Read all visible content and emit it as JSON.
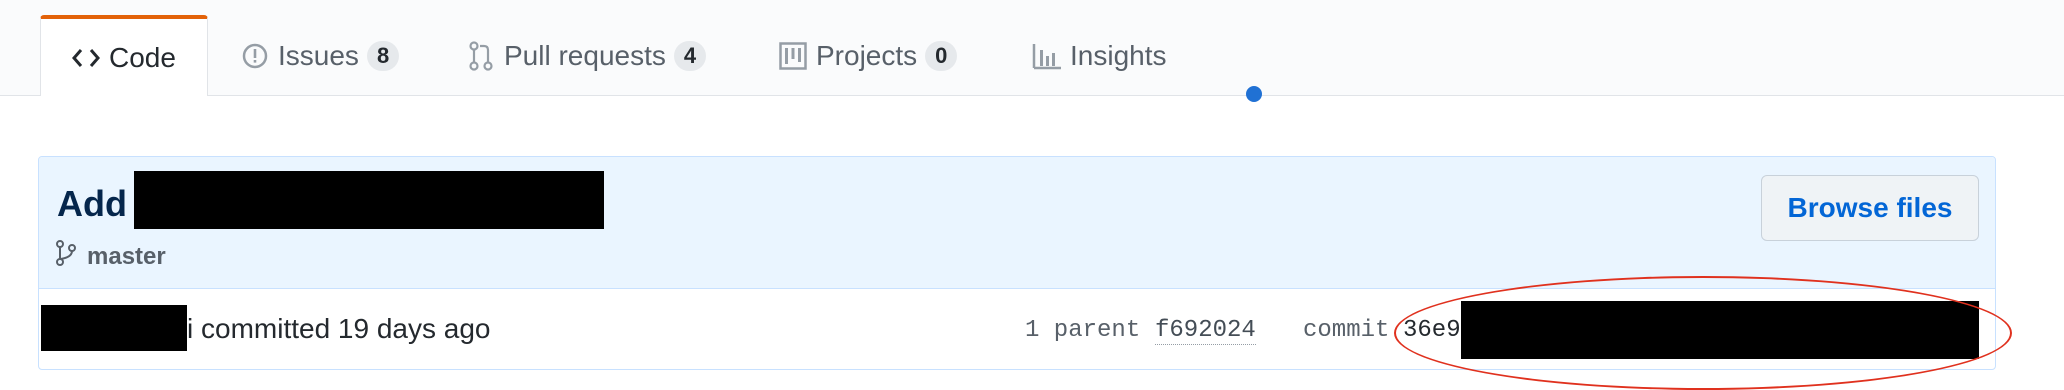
{
  "tabs": {
    "code": {
      "label": "Code",
      "icon": "code-icon"
    },
    "issues": {
      "label": "Issues",
      "count": "8",
      "icon": "issue-opened-icon"
    },
    "pulls": {
      "label": "Pull requests",
      "count": "4",
      "icon": "git-pull-request-icon"
    },
    "projects": {
      "label": "Projects",
      "count": "0",
      "icon": "project-icon"
    },
    "insights": {
      "label": "Insights",
      "icon": "graph-icon"
    }
  },
  "commit": {
    "title_prefix": "Add",
    "branch": "master",
    "browse_label": "Browse files",
    "author_suffix": "i",
    "committed_text": "committed 19 days ago",
    "parent_label": "1 parent",
    "parent_sha": "f692024",
    "commit_label": "commit",
    "commit_sha_visible": "36e9"
  },
  "colors": {
    "selected_tab_accent": "#e36209",
    "header_bg": "#eaf5ff",
    "link_blue": "#0366d6",
    "annotation_red": "#e0311e",
    "dot_blue": "#2071d4"
  }
}
